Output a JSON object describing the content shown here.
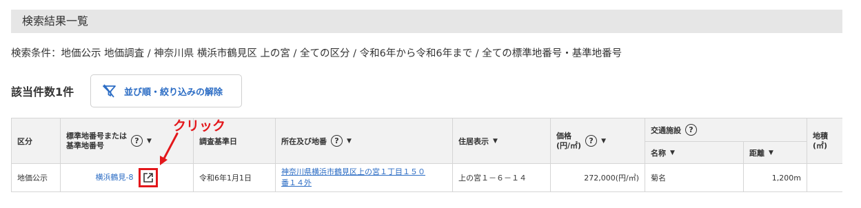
{
  "section_title": "検索結果一覧",
  "conditions": "検索条件：地価公示 地価調査 / 神奈川県 横浜市鶴見区 上の宮 / 全ての区分 / 令和6年から令和6年まで / 全ての標準地番号・基準地番号",
  "result_count": "該当件数1件",
  "reset_button": "並び順・絞り込みの解除",
  "annotation": "クリック",
  "help_glyph": "?",
  "sort_glyph": "▼",
  "table": {
    "headers": {
      "category": "区分",
      "standard_number_line1": "標準地番号または",
      "standard_number_line2": "基準地番号",
      "survey_date": "調査基準日",
      "address": "所在及び地番",
      "residence": "住居表示",
      "price_line1": "価格",
      "price_line2": "(円/㎡)",
      "transport": "交通施設",
      "name": "名称",
      "distance": "距離",
      "area_line1": "地積",
      "area_line2": "(㎡)"
    },
    "rows": [
      {
        "category": "地価公示",
        "standard_number": "横浜鶴見-8",
        "survey_date": "令和6年1月1日",
        "address_line1": "神奈川県横浜市鶴見区上の宮１丁目１５０",
        "address_line2": "番１４外",
        "residence": "上の宮１－６－１４",
        "price": "272,000(円/㎡)",
        "station": "菊名",
        "distance": "1,200m",
        "area": ""
      }
    ]
  },
  "colors": {
    "link": "#2b6cc4",
    "annotation": "#e3171b",
    "header_bg": "#f2f2f2",
    "section_bg": "#e6e6e6"
  }
}
